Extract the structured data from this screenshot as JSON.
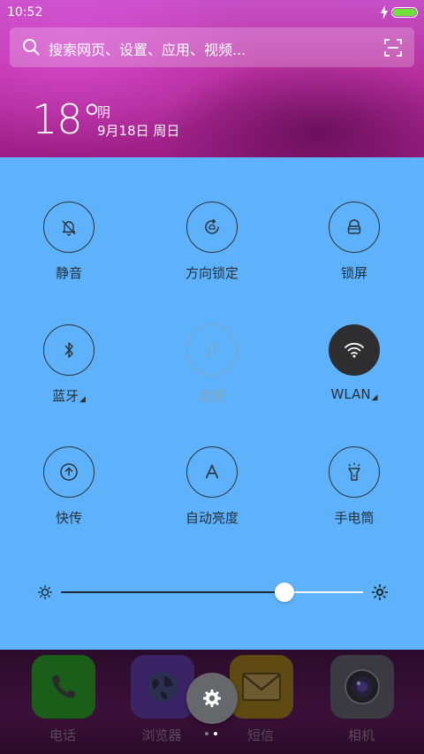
{
  "status_bar": {
    "time": "10:52"
  },
  "search": {
    "placeholder": "搜索网页、设置、应用、视频..."
  },
  "weather": {
    "temperature": "18°",
    "condition": "阴",
    "date": "9月18日 周日"
  },
  "toggles": [
    {
      "label": "静音",
      "icon": "bell-mute-icon",
      "state": "off"
    },
    {
      "label": "方向锁定",
      "icon": "rotation-lock-icon",
      "state": "off"
    },
    {
      "label": "锁屏",
      "icon": "lock-icon",
      "state": "off"
    },
    {
      "label": "蓝牙",
      "icon": "bluetooth-icon",
      "state": "off",
      "has_menu": true
    },
    {
      "label": "数据",
      "icon": "mobile-data-icon",
      "state": "disabled"
    },
    {
      "label": "WLAN",
      "icon": "wifi-icon",
      "state": "on",
      "has_menu": true
    },
    {
      "label": "快传",
      "icon": "quick-transfer-icon",
      "state": "off"
    },
    {
      "label": "自动亮度",
      "icon": "auto-brightness-icon",
      "state": "off"
    },
    {
      "label": "手电筒",
      "icon": "flashlight-icon",
      "state": "off"
    }
  ],
  "brightness": {
    "level": 0.74
  },
  "dock": {
    "apps": [
      {
        "label": "电话",
        "icon": "phone-icon"
      },
      {
        "label": "浏览器",
        "icon": "browser-globe-icon"
      },
      {
        "label": "短信",
        "icon": "message-envelope-icon"
      },
      {
        "label": "相机",
        "icon": "camera-icon"
      }
    ],
    "page_count": 2,
    "current_page": 2
  },
  "colors": {
    "panel_bg": "#5db2fb",
    "active_toggle": "#2e2e30",
    "battery": "#6ee23a"
  }
}
